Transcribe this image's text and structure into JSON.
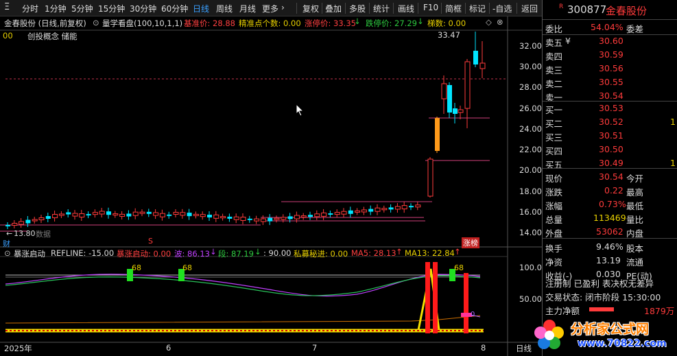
{
  "toolbar": {
    "menu_glyph": "Ξ",
    "periods": [
      "分时",
      "1分钟",
      "5分钟",
      "15分钟",
      "30分钟",
      "60分钟",
      "日线",
      "周线",
      "月线",
      "更多"
    ],
    "more_arrow": "›",
    "actions": [
      "复权",
      "叠加",
      "多股",
      "统计",
      "画线",
      "F10",
      "简框",
      "标记",
      "-自选",
      "返回"
    ]
  },
  "chart": {
    "stock_title": "金春股份 (日线,前复权)",
    "indicator_name": "量学看盘(100,10,1,1)",
    "base_price": "基准价: 28.88",
    "precise_points": "精准点个数: 0.00",
    "limit_up": "涨停价: 33.35",
    "limit_down": "跌停价: 27.29",
    "steps": "梯数: 0.00",
    "row2_left": "00",
    "concept": "创投概念 储能",
    "peak_label": "33.47",
    "low_label": "13.80",
    "low_marker": "←",
    "data_overlay": "数据",
    "cai_label": "财",
    "s_label": "S",
    "zhangbang_label": "涨榜",
    "y_ticks": [
      "32.00",
      "30.00",
      "28.00",
      "26.00",
      "24.00",
      "22.00",
      "20.00",
      "18.00",
      "16.00",
      "14.00"
    ],
    "x_labels": [
      "2025年",
      "6",
      "7",
      "8"
    ],
    "x_right_label": "日线"
  },
  "sub": {
    "name": "暴涨启动",
    "refline": "REFLINE: -15.00",
    "start_val": "暴涨启动: 0.00",
    "wave": "波: 86.13",
    "segment": "段: 87.19",
    "colon90": ": 90.00",
    "secret": "私募秘进: 0.00",
    "ma5": "MA5: 28.13",
    "ma13": "MA13: 22.84",
    "y_ticks": [
      "100.0",
      "50.00"
    ],
    "marker_labels": [
      "68",
      "68",
      "68"
    ],
    "small_marker": "0"
  },
  "quote": {
    "code": "300877",
    "name": "金春股份",
    "weibi_label": "委比",
    "weibi_value": "54.04%",
    "weicha_label": "委差",
    "sells": [
      {
        "label": "卖五",
        "price": "30.60",
        "yen": "¥"
      },
      {
        "label": "卖四",
        "price": "30.59"
      },
      {
        "label": "卖三",
        "price": "30.56"
      },
      {
        "label": "卖二",
        "price": "30.55"
      },
      {
        "label": "卖一",
        "price": "30.54"
      }
    ],
    "buys": [
      {
        "label": "买一",
        "price": "30.53",
        "vol": ""
      },
      {
        "label": "买二",
        "price": "30.52",
        "vol": "1"
      },
      {
        "label": "买三",
        "price": "30.51",
        "vol": ""
      },
      {
        "label": "买四",
        "price": "30.50",
        "vol": ""
      },
      {
        "label": "买五",
        "price": "30.49",
        "vol": "1"
      }
    ],
    "stats": [
      {
        "label": "现价",
        "value": "30.54",
        "label2": "今开"
      },
      {
        "label": "涨跌",
        "value": "0.22",
        "label2": "最高"
      },
      {
        "label": "涨幅",
        "value": "0.73%",
        "label2": "最低"
      },
      {
        "label": "总量",
        "value": "113469",
        "label2": "量比"
      },
      {
        "label": "外盘",
        "value": "53062",
        "label2": "内盘"
      }
    ],
    "stats2": [
      {
        "label": "换手",
        "value": "9.46%",
        "label2": "股本"
      },
      {
        "label": "净资",
        "value": "13.19",
        "label2": "流通"
      },
      {
        "label": "收益(-)",
        "value": "0.030",
        "label2": "PE(动)"
      }
    ],
    "reg_info": "注册制 已盈利 表决权无差异",
    "trade_status": "交易状态: 闭市阶段 15:30:00",
    "main_net_label": "主力净额",
    "main_net_value": "1879万"
  },
  "watermark": {
    "line1": "分析家公式网",
    "line2": "www.70822.com"
  },
  "colors": {
    "up": "#ff3b3b",
    "down": "#00e5ff",
    "toolbar_active": "#3aa0ff",
    "yellow": "#e8d000",
    "grid": "#333333"
  }
}
